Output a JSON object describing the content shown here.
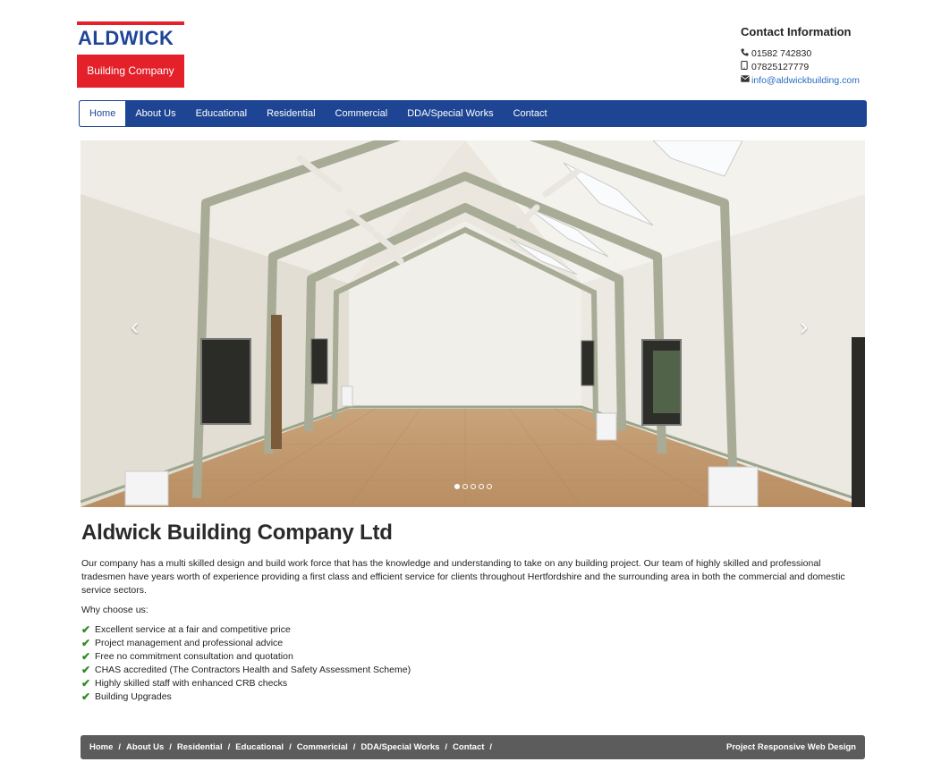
{
  "logo": {
    "name": "ALDWICK",
    "tagline": "Building Company"
  },
  "contact": {
    "title": "Contact Information",
    "phone": "01582 742830",
    "mobile": "07825127779",
    "email": "info@aldwickbuilding.com"
  },
  "nav": {
    "items": [
      "Home",
      "About Us",
      "Educational",
      "Residential",
      "Commercial",
      "DDA/Special Works",
      "Contact"
    ],
    "active": "Home"
  },
  "carousel": {
    "prev_glyph": "‹",
    "next_glyph": "›",
    "slide_count": 5,
    "active_slide": 1
  },
  "main": {
    "heading": "Aldwick Building Company Ltd",
    "intro": "Our company has a multi skilled design and build work force that has the knowledge and understanding to take on any building project. Our team of highly skilled and professional tradesmen have years worth of experience providing a first class and efficient service for clients throughout Hertfordshire and the surrounding area in both the commercial and domestic service sectors.",
    "why_label": "Why choose us:",
    "reasons": [
      "Excellent service at a fair and competitive price",
      "Project management and professional advice",
      "Free no commitment consultation and quotation",
      "CHAS accredited (The Contractors Health and Safety Assessment Scheme)",
      "Highly skilled staff with enhanced CRB checks",
      "Building Upgrades"
    ]
  },
  "footer": {
    "links": [
      "Home",
      "About Us",
      "Residential",
      "Educational",
      "Commericial",
      "DDA/Special Works",
      "Contact"
    ],
    "separator": "/",
    "credit": "Project Responsive Web Design"
  },
  "colors": {
    "brand_blue": "#1e4593",
    "brand_red": "#e4202a",
    "link_blue": "#2a6cc0",
    "check_green": "#2e8b23",
    "footer_gray": "#5c5c5c"
  },
  "icons": {
    "phone": "phone-icon",
    "mobile": "mobile-icon",
    "email": "envelope-icon",
    "check": "check-icon"
  }
}
